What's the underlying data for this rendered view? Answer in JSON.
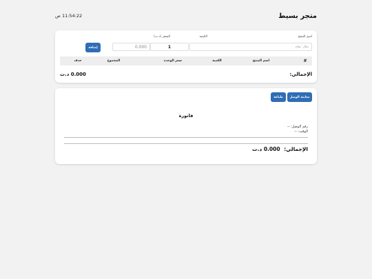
{
  "header": {
    "title": "متجر بسيط",
    "time": "11:54:22 ص"
  },
  "entry_form": {
    "product_name_label": "اسم المنتج",
    "product_name_placeholder": "مثال: تفاح",
    "quantity_label": "الكمية",
    "quantity_value": "1",
    "price_label": "السعر (د.ت)",
    "price_value": "0.000",
    "add_button": "إضافة"
  },
  "items_table": {
    "columns": [
      "#",
      "اسم المنتج",
      "الكمية",
      "سعر الوحدة",
      "المجموع",
      "حذف"
    ],
    "rows": []
  },
  "summary": {
    "total_label": "الإجمالي:",
    "total_value": "0.000 د.ت"
  },
  "receipt": {
    "preview_button": "معاينة الوصل",
    "print_button": "طباعة",
    "title": "فاتورة",
    "receipt_number_line": "رقم الوصل: --",
    "time_line": "الوقت: --",
    "total_label": "الإجمالي:",
    "total_value": "0.000 د.ت"
  },
  "colors": {
    "accent": "#2f6db5",
    "background": "#f2f2f2",
    "table_header": "#eeeeee"
  }
}
